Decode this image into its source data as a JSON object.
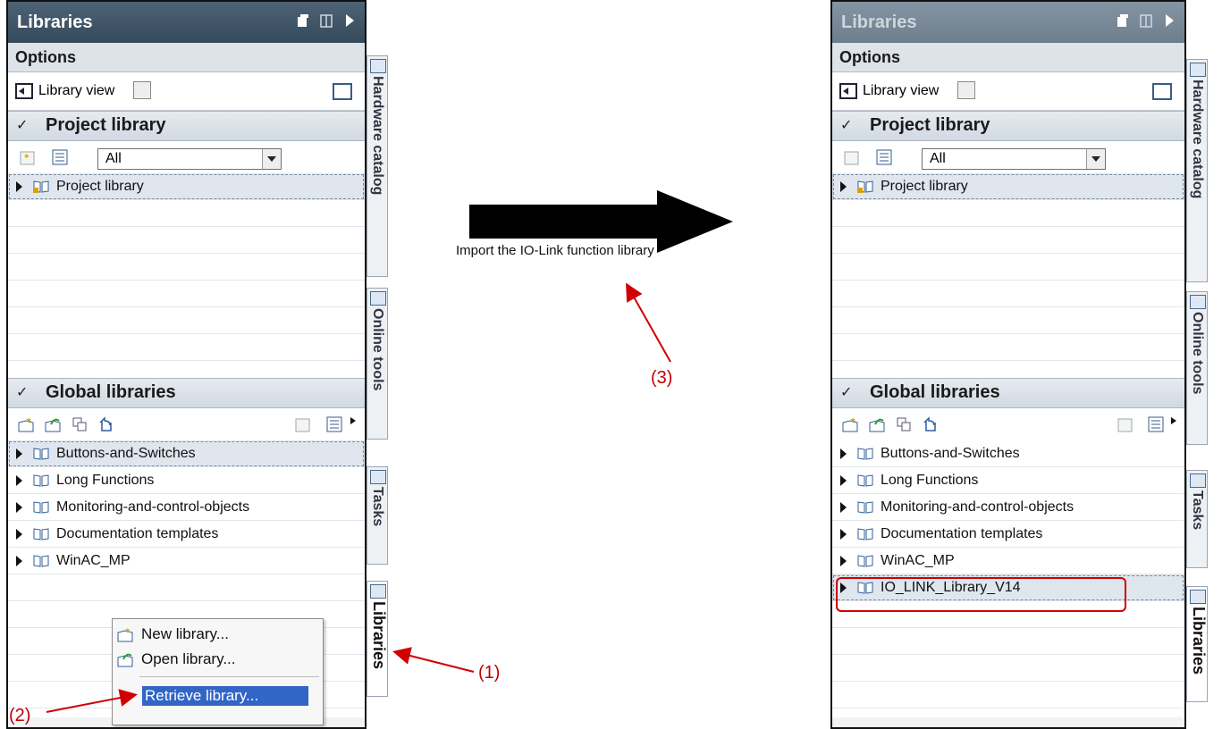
{
  "left": {
    "title": "Libraries",
    "options_label": "Options",
    "library_view_label": "Library view",
    "project_section_label": "Project library",
    "filter_value": "All",
    "project_items": [
      "Project library"
    ],
    "global_section_label": "Global libraries",
    "global_items": [
      "Buttons-and-Switches",
      "Long Functions",
      "Monitoring-and-control-objects",
      "Documentation templates",
      "WinAC_MP"
    ],
    "tabs": [
      "Hardware catalog",
      "Online tools",
      "Tasks",
      "Libraries"
    ],
    "context_menu": [
      "New library...",
      "Open library...",
      "Retrieve library..."
    ]
  },
  "right": {
    "title": "Libraries",
    "options_label": "Options",
    "library_view_label": "Library view",
    "project_section_label": "Project library",
    "filter_value": "All",
    "project_items": [
      "Project library"
    ],
    "global_section_label": "Global libraries",
    "global_items": [
      "Buttons-and-Switches",
      "Long Functions",
      "Monitoring-and-control-objects",
      "Documentation templates",
      "WinAC_MP",
      "IO_LINK_Library_V14"
    ],
    "tabs": [
      "Hardware catalog",
      "Online tools",
      "Tasks",
      "Libraries"
    ]
  },
  "annotations": {
    "step1": "(1)",
    "step2": "(2)",
    "step3": "(3)",
    "arrow_caption": "Import the IO-Link function library"
  },
  "colors": {
    "annotation": "#c00000",
    "titlebar": "#3f5567",
    "selection": "#3165c6"
  }
}
